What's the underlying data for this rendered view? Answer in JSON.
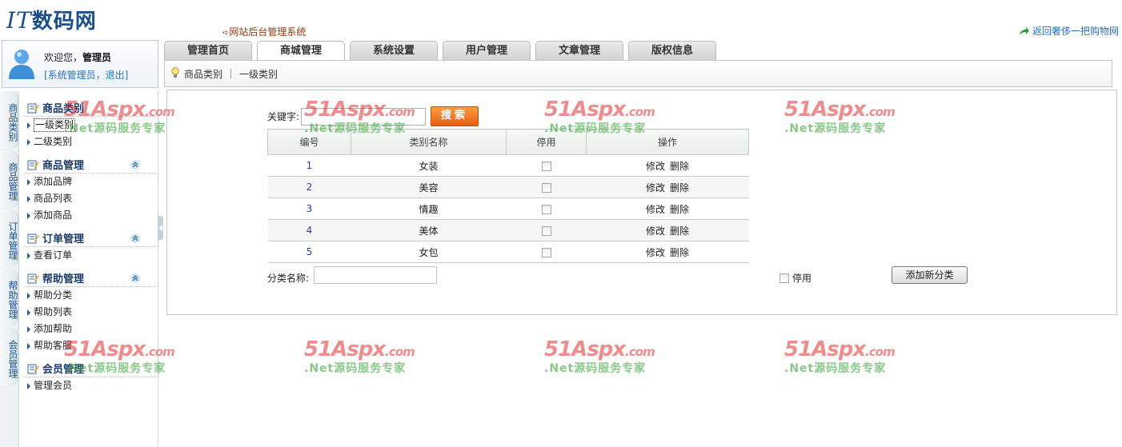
{
  "header": {
    "logo_latin": "IT",
    "logo_cn": "数码网",
    "system_title": "网站后台管理系统",
    "back_link": "返回奢侈一把购物网"
  },
  "user": {
    "welcome_prefix": "欢迎您，",
    "name": "管理员",
    "links": "[系统管理员，退出]"
  },
  "tabs": [
    {
      "label": "管理首页",
      "active": false
    },
    {
      "label": "商城管理",
      "active": true
    },
    {
      "label": "系统设置",
      "active": false
    },
    {
      "label": "用户管理",
      "active": false
    },
    {
      "label": "文章管理",
      "active": false
    },
    {
      "label": "版权信息",
      "active": false
    }
  ],
  "breadcrumb": {
    "first": "商品类别",
    "second": "一级类别"
  },
  "side_tabs": [
    "商品类别",
    "商品管理",
    "订单管理",
    "帮助管理",
    "会员管理"
  ],
  "menu": [
    {
      "title": "商品类别",
      "items": [
        "一级类别",
        "二级类别"
      ],
      "collapsible": false
    },
    {
      "title": "商品管理",
      "items": [
        "添加品牌",
        "商品列表",
        "添加商品"
      ],
      "collapsible": true
    },
    {
      "title": "订单管理",
      "items": [
        "查看订单"
      ],
      "collapsible": true
    },
    {
      "title": "帮助管理",
      "items": [
        "帮助分类",
        "帮助列表",
        "添加帮助",
        "帮助客服"
      ],
      "collapsible": true
    },
    {
      "title": "会员管理",
      "items": [
        "管理会员"
      ],
      "collapsible": false
    }
  ],
  "search": {
    "label": "关键字:",
    "value": "",
    "button": "搜索"
  },
  "table": {
    "headers": [
      "编号",
      "类别名称",
      "停用",
      "操作"
    ],
    "rows": [
      {
        "id": "1",
        "name": "女装",
        "disabled": false
      },
      {
        "id": "2",
        "name": "美容",
        "disabled": false
      },
      {
        "id": "3",
        "name": "情趣",
        "disabled": false
      },
      {
        "id": "4",
        "name": "美体",
        "disabled": false
      },
      {
        "id": "5",
        "name": "女包",
        "disabled": false
      }
    ],
    "edit_label": "修改",
    "delete_label": "删除"
  },
  "add_form": {
    "name_label": "分类名称:",
    "name_value": "",
    "disable_label": "停用",
    "add_button": "添加新分类"
  },
  "watermark": {
    "brand": "51Aspx",
    "domain": ".com",
    "slogan": ".Net源码服务专家"
  },
  "colors": {
    "brand_blue": "#1a4f8a",
    "search_orange": "#f07a22",
    "watermark_red": "#dc3232",
    "watermark_green": "#3ca03c"
  }
}
